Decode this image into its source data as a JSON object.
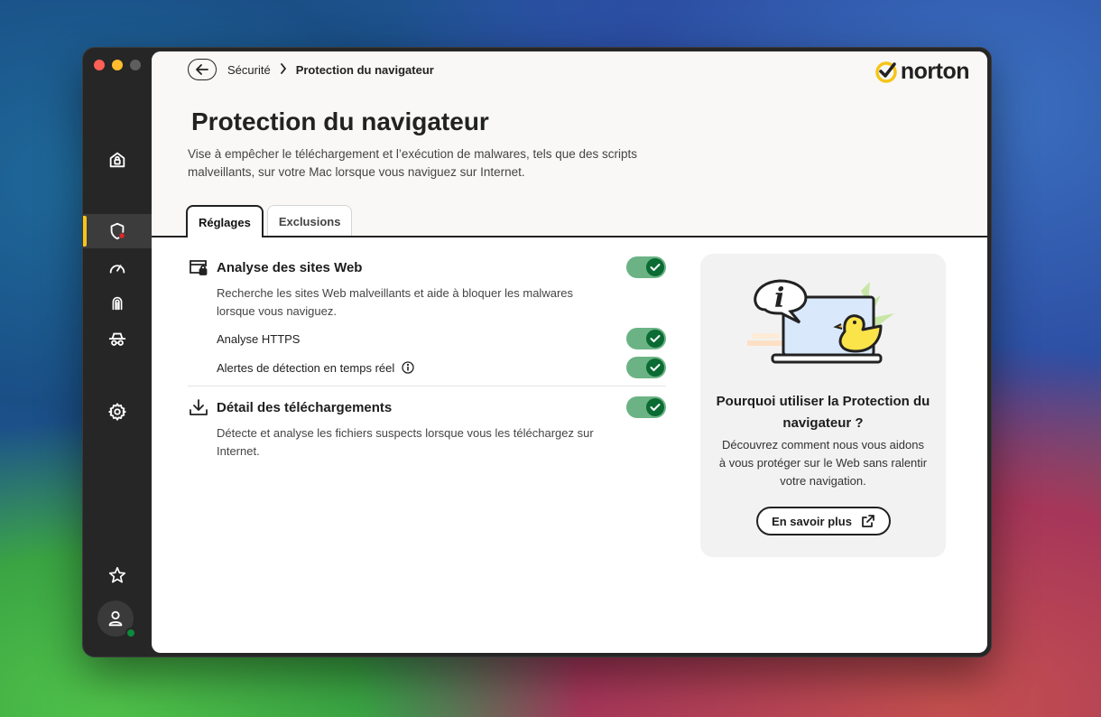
{
  "colors": {
    "accent_yellow": "#f5c518",
    "toggle_on": "#6bb384",
    "toggle_knob": "#0a6b33",
    "status_online": "#0a8a3a"
  },
  "sidebar": {
    "items": [
      {
        "name": "home",
        "icon": "home-lock-icon"
      },
      {
        "name": "security",
        "icon": "shield-alert-icon",
        "active": true
      },
      {
        "name": "performance",
        "icon": "speedometer-icon"
      },
      {
        "name": "identity",
        "icon": "fingerprint-icon"
      },
      {
        "name": "privacy",
        "icon": "incognito-icon"
      },
      {
        "name": "settings",
        "icon": "gear-icon"
      },
      {
        "name": "favorites",
        "icon": "star-icon"
      },
      {
        "name": "account",
        "icon": "user-icon"
      }
    ]
  },
  "breadcrumb": {
    "parent": "Sécurité",
    "current": "Protection du navigateur"
  },
  "brand": {
    "name": "norton"
  },
  "page": {
    "title": "Protection du navigateur",
    "description": "Vise à empêcher le téléchargement et l’exécution de malwares, tels que des scripts malveillants, sur votre Mac lorsque vous naviguez sur Internet."
  },
  "tabs": [
    {
      "label": "Réglages",
      "active": true
    },
    {
      "label": "Exclusions",
      "active": false
    }
  ],
  "settings": {
    "web_analysis": {
      "title": "Analyse des sites Web",
      "description": "Recherche les sites Web malveillants et aide à bloquer les malwares lorsque vous naviguez.",
      "enabled": true,
      "sub": [
        {
          "label": "Analyse HTTPS",
          "enabled": true
        },
        {
          "label": "Alertes de détection en temps réel",
          "enabled": true
        }
      ]
    },
    "downloads": {
      "title": "Détail des téléchargements",
      "description": "Détecte et analyse les fichiers suspects lorsque vous les téléchargez sur Internet.",
      "enabled": true
    }
  },
  "promo": {
    "title": "Pourquoi utiliser la Protection du navigateur ?",
    "text": "Découvrez comment nous vous aidons à vous protéger sur le Web sans ralentir votre navigation.",
    "button": "En savoir plus"
  }
}
